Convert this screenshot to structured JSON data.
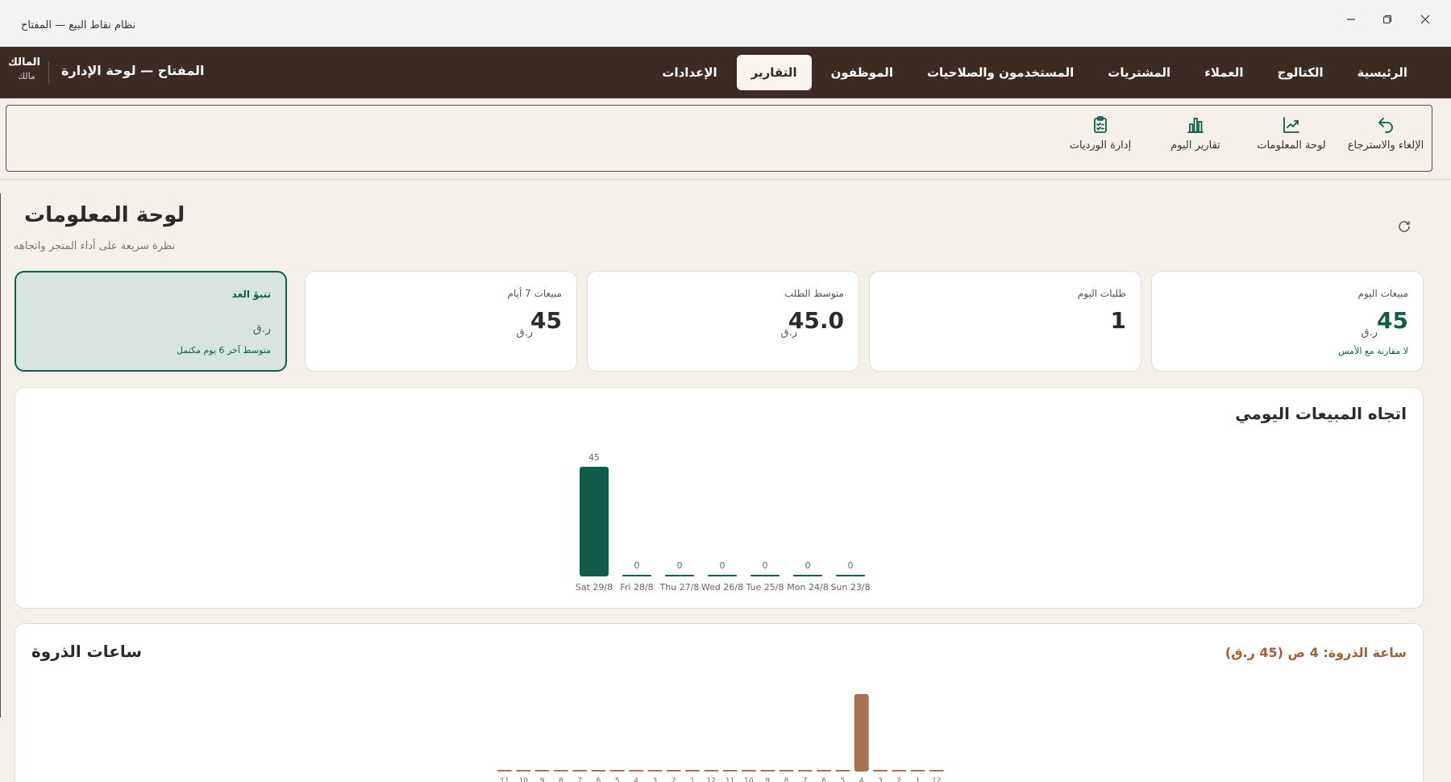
{
  "window": {
    "title": "نظام نقاط البيع — المفتاح",
    "min_icon": "minimize-icon",
    "max_icon": "restore-icon",
    "close_icon": "close-icon"
  },
  "topnav": {
    "user_name": "المالك",
    "user_role": "مالك",
    "brand": "المفتاح — لوحة الإدارة",
    "items": [
      {
        "label": "الرئيسية",
        "active": false
      },
      {
        "label": "الكتالوج",
        "active": false
      },
      {
        "label": "العملاء",
        "active": false
      },
      {
        "label": "المشتريات",
        "active": false
      },
      {
        "label": "المستخدمون والصلاحيات",
        "active": false
      },
      {
        "label": "الموظفون",
        "active": false
      },
      {
        "label": "التقارير",
        "active": true
      },
      {
        "label": "الإعدادات",
        "active": false
      }
    ]
  },
  "subnav": {
    "items": [
      {
        "label": "الإلغاء والاسترجاع",
        "icon": "undo-icon"
      },
      {
        "label": "لوحة المعلومات",
        "icon": "trend-chart-icon"
      },
      {
        "label": "تقارير اليوم",
        "icon": "bar-chart-icon"
      },
      {
        "label": "إدارة الورديات",
        "icon": "clipboard-icon"
      }
    ]
  },
  "page": {
    "title": "لوحة المعلومات",
    "subtitle": "نظرة سريعة على أداء المتجر واتجاهه",
    "refresh_icon": "refresh-icon"
  },
  "kpis": {
    "today_sales": {
      "label": "مبيعات اليوم",
      "value": "45",
      "unit": "ر.ق",
      "note": "لا مقارنة مع الأمس"
    },
    "today_orders": {
      "label": "طلبات اليوم",
      "value": "1"
    },
    "avg_order": {
      "label": "متوسط الطلب",
      "value": "45.0",
      "unit": "ر.ق"
    },
    "week_sales": {
      "label": "مبيعات 7 أيام",
      "value": "45",
      "unit": "ر.ق"
    },
    "forecast": {
      "label": "تنبؤ الغد",
      "unit": "ر.ق",
      "note": "متوسط آخر 6 يوم مكتمل"
    }
  },
  "daily_panel": {
    "title": "اتجاه المبيعات اليومي"
  },
  "peak_panel": {
    "title": "ساعات الذروة",
    "peak_text": "ساعة الذروة: 4 ص (45 ر.ق)"
  },
  "colors": {
    "nav_bg": "#3d2b22",
    "accent_green": "#0f5c4a",
    "accent_brown": "#a87352",
    "page_bg": "#f5f1ea"
  },
  "chart_data": [
    {
      "type": "bar",
      "title": "اتجاه المبيعات اليومي",
      "categories": [
        "Sat 29/8",
        "Fri 28/8",
        "Thu 27/8",
        "Wed 26/8",
        "Tue 25/8",
        "Mon 24/8",
        "Sun 23/8"
      ],
      "values": [
        45,
        0,
        0,
        0,
        0,
        0,
        0
      ],
      "ylim": [
        0,
        45
      ],
      "grid": false,
      "color": "#0f5c4a"
    },
    {
      "type": "bar",
      "title": "ساعات الذروة",
      "categories": [
        "11",
        "10",
        "9",
        "8",
        "7",
        "6",
        "5",
        "4",
        "3",
        "2",
        "1",
        "12",
        "11",
        "10",
        "9",
        "8",
        "7",
        "6",
        "5",
        "4",
        "3",
        "2",
        "1",
        "12"
      ],
      "values": [
        0,
        0,
        0,
        0,
        0,
        0,
        0,
        0,
        0,
        0,
        0,
        0,
        0,
        0,
        0,
        0,
        0,
        0,
        0,
        45,
        0,
        0,
        0,
        0
      ],
      "ylim": [
        0,
        45
      ],
      "grid": false,
      "color": "#a87352"
    }
  ]
}
